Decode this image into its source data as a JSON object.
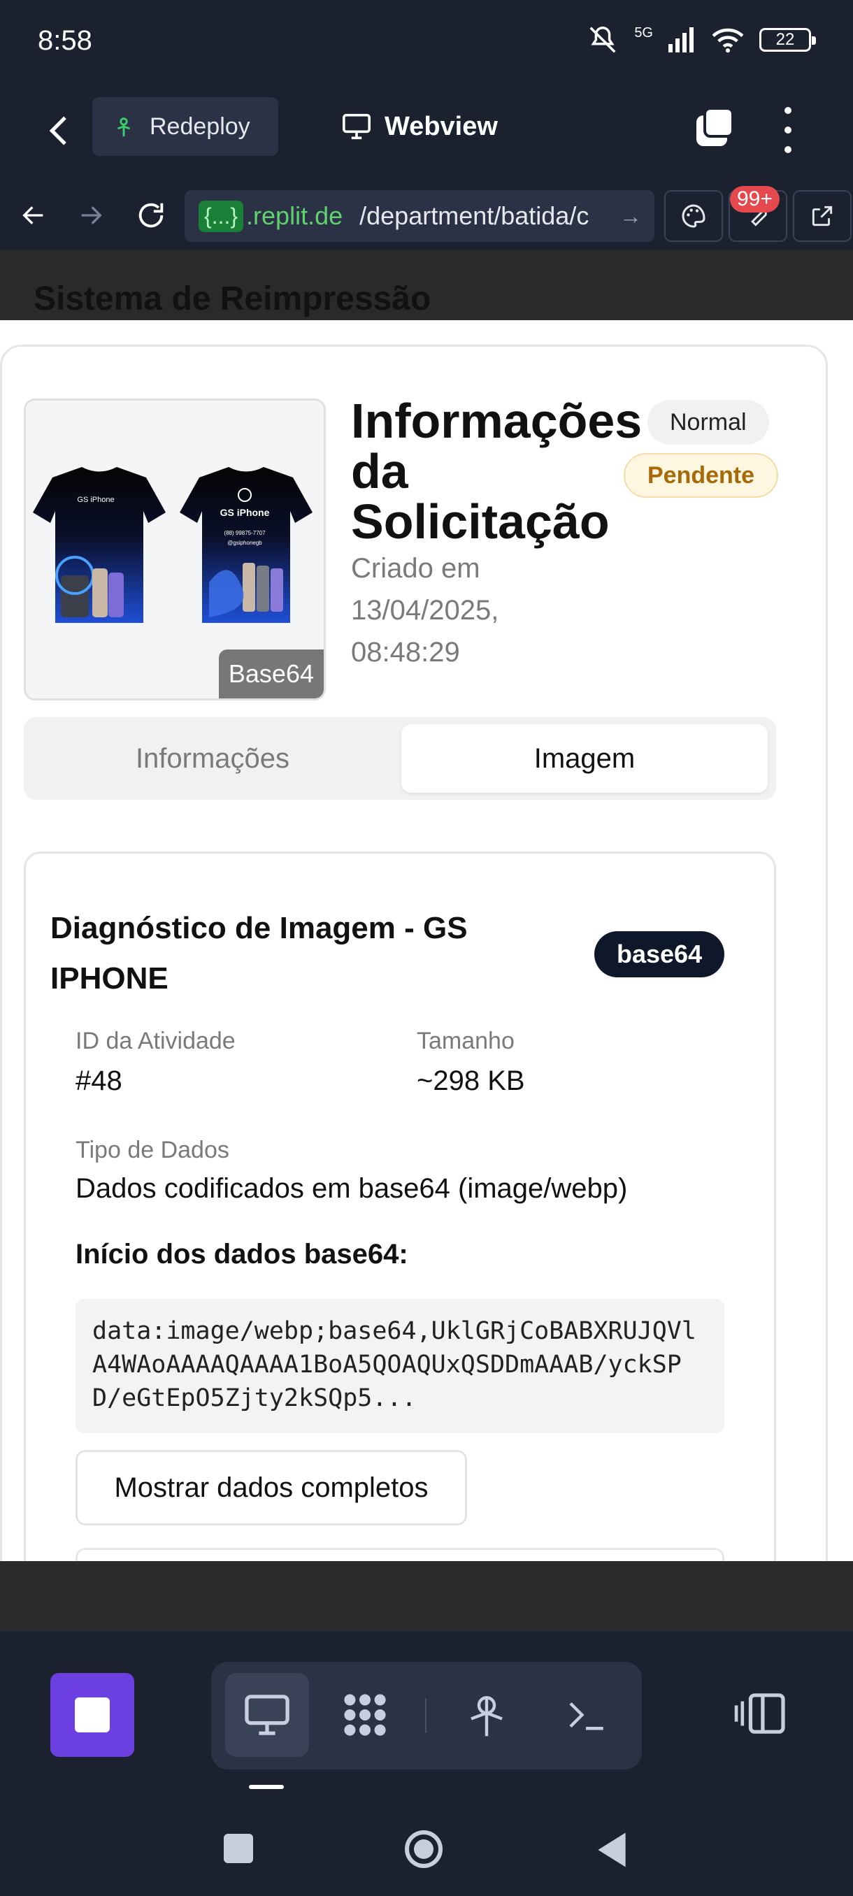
{
  "status_bar": {
    "time": "8:58",
    "network": "5G",
    "battery": "22"
  },
  "topbar": {
    "redeploy_label": "Redeploy",
    "webview_label": "Webview"
  },
  "urlbar": {
    "badge": "{...}",
    "host": ".replit.de",
    "path": "/department/batida/c",
    "notification_count": "99+"
  },
  "page": {
    "header_title": "Sistema de Reimpressão",
    "thumbnail_label": "Base64",
    "info_title": "Informações da Solicitação",
    "created": "Criado em 13/04/2025, 08:48:29",
    "badge_priority": "Normal",
    "badge_status": "Pendente",
    "tabs": [
      {
        "label": "Informações"
      },
      {
        "label": "Imagem"
      }
    ],
    "diagnostic": {
      "title": "Diagnóstico de Imagem - GS IPHONE",
      "badge": "base64",
      "activity_label": "ID da Atividade",
      "activity_value": "#48",
      "size_label": "Tamanho",
      "size_value": "~298 KB",
      "type_label": "Tipo de Dados",
      "type_value": "Dados codificados em base64 (image/webp)",
      "start_label": "Início dos dados base64:",
      "code": "data:image/webp;base64,UklGRjCoBABXRUJQVlA4WAoAAAAQAAAA1BoA5QOAQUxQSDDmAAAB/yckSPD/eGtEpO5Zjty2kSQp5...",
      "show_button": "Mostrar dados completos"
    }
  },
  "colors": {
    "accent": "#6b3fe0",
    "ide_bg": "#1c2130",
    "pending": "#a86a08",
    "dark_badge": "#0f172a"
  }
}
